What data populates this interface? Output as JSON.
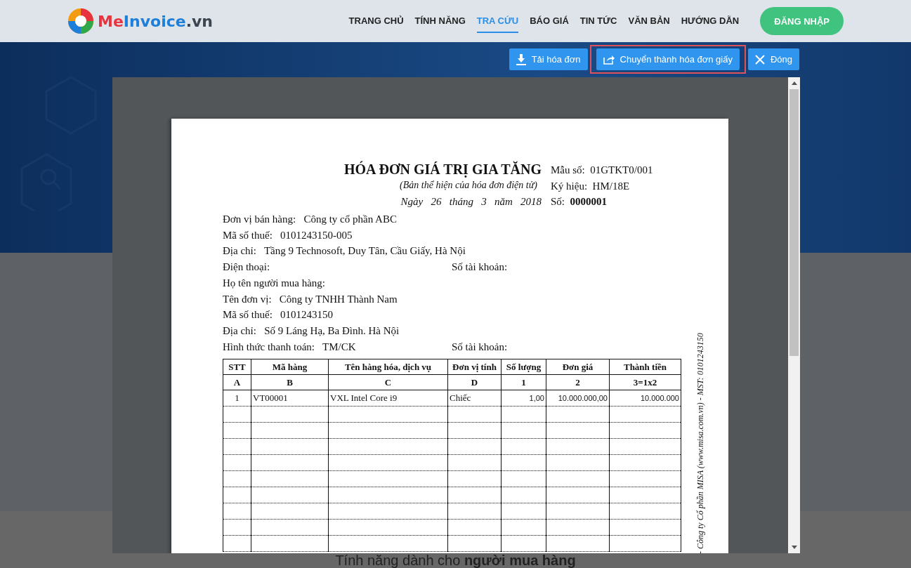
{
  "header": {
    "logo_parts": [
      {
        "text": "Me",
        "color": "#e8343f"
      },
      {
        "text": "Invoice",
        "color": "#1e7fd8"
      },
      {
        "text": ".vn",
        "color": "#3d4650"
      }
    ],
    "nav": [
      {
        "label": "TRANG CHỦ",
        "selected": false
      },
      {
        "label": "TÍNH NĂNG",
        "selected": false
      },
      {
        "label": "TRA CỨU",
        "selected": true
      },
      {
        "label": "BÁO GIÁ",
        "selected": false
      },
      {
        "label": "TIN TỨC",
        "selected": false
      },
      {
        "label": "VĂN BẢN",
        "selected": false
      },
      {
        "label": "HƯỚNG DẪN",
        "selected": false
      }
    ],
    "login_button": "ĐĂNG NHẬP"
  },
  "viewer": {
    "toolbar": [
      {
        "kind": "download",
        "label": "Tải hóa đơn",
        "highlighted": false
      },
      {
        "kind": "share",
        "label": "Chuyển thành hóa đơn giấy",
        "highlighted": true
      },
      {
        "kind": "close",
        "label": "Đóng",
        "highlighted": false
      }
    ],
    "invoice": {
      "title": "HÓA ĐƠN GIÁ TRỊ GIA TĂNG",
      "subtitle": "(Bản thể hiện của hóa đơn điện tử)",
      "date": [
        "Ngày",
        "26",
        "tháng",
        "3",
        "năm",
        "2018"
      ],
      "meta": [
        {
          "label": "Mẫu số:",
          "value": "01GTKT0/001",
          "bold": false
        },
        {
          "label": "Ký hiệu:",
          "value": "HM/18E",
          "bold": false
        },
        {
          "label": "Số:",
          "value": "0000001",
          "bold": true
        }
      ],
      "fields": [
        {
          "label": "Đơn vị bán hàng:",
          "value": "Công ty cổ phần ABC"
        },
        {
          "label": "Mã số thuế:",
          "value": "0101243150-005"
        },
        {
          "label": "Địa chỉ:",
          "value": "Tầng 9 Technosoft, Duy Tân, Cầu Giấy, Hà Nội"
        },
        {
          "label": "Điện thoại:",
          "right_label": "Số tài khoản:"
        },
        {
          "label": "Họ tên người mua hàng:"
        },
        {
          "label": "Tên đơn vị:",
          "value": "Công ty TNHH Thành Nam"
        },
        {
          "label": "Mã số thuế:",
          "value": "0101243150"
        },
        {
          "label": "Địa chỉ:",
          "value": "Số 9 Láng Hạ, Ba Đình. Hà Nội"
        },
        {
          "label": "Hình thức thanh toán:",
          "value": "TM/CK",
          "right_label": "Số tài khoản:"
        }
      ],
      "table": {
        "columns": [
          "STT",
          "Mã hàng",
          "Tên hàng hóa, dịch vụ",
          "Đơn vị tính",
          "Số lượng",
          "Đơn giá",
          "Thành tiền"
        ],
        "codes": [
          "A",
          "B",
          "C",
          "D",
          "1",
          "2",
          "3=1x2"
        ],
        "rows": [
          [
            "1",
            "VT00001",
            "VXL Intel Core i9",
            "Chiếc",
            "1,00",
            "10.000.000,00",
            "10.000.000"
          ]
        ]
      },
      "side_note": "- Công ty Cổ phần MISA (www.misa.com.vn) - MST: 0101243150"
    }
  },
  "section_heading": "Tính năng dành cho **người mua hàng**"
}
